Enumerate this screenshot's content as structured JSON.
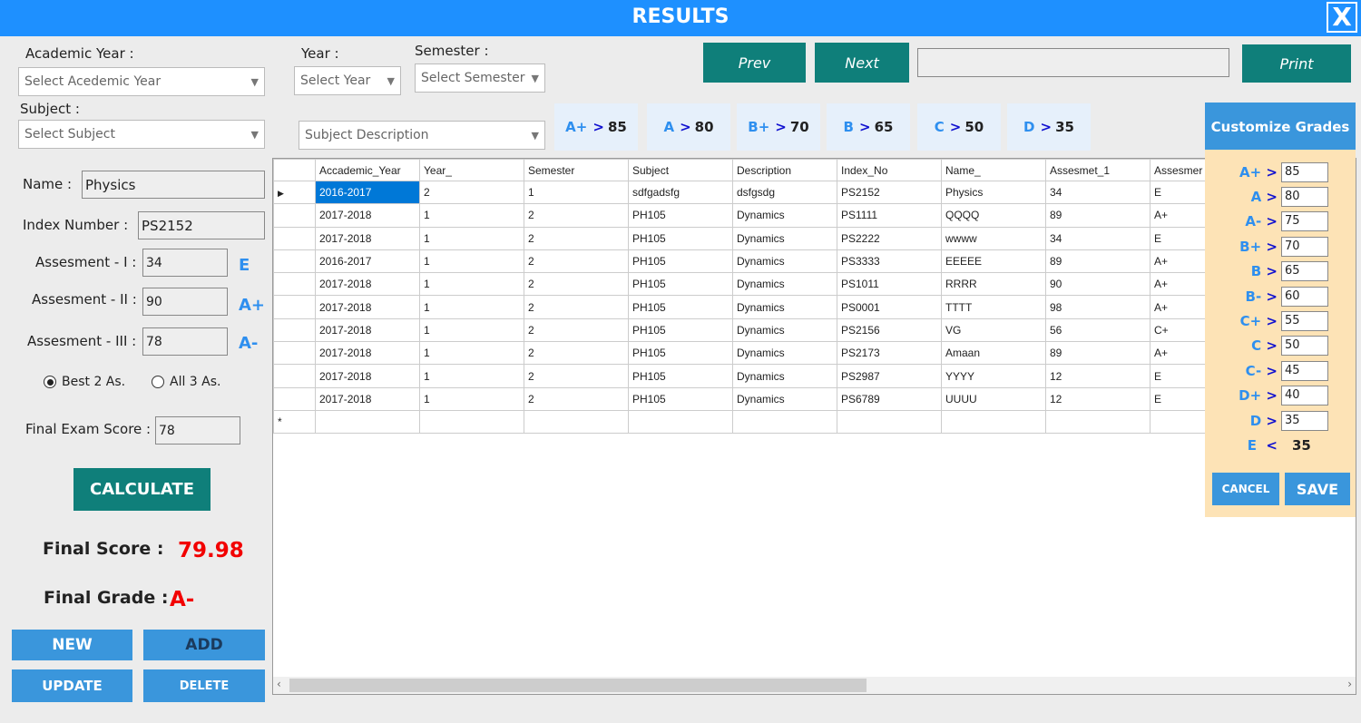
{
  "title": "RESULTS",
  "close_label": "X",
  "filters": {
    "academic_year_label": "Academic Year :",
    "academic_year_value": "Select Acedemic Year",
    "year_label": "Year :",
    "year_value": "Select Year",
    "semester_label": "Semester :",
    "semester_value": "Select Semester",
    "subject_label": "Subject :",
    "subject_value": "Select Subject",
    "description_value": "Subject Description"
  },
  "nav": {
    "prev": "Prev",
    "next": "Next",
    "search_value": "",
    "print": "Print"
  },
  "grade_chips": [
    {
      "g": "A+",
      "v": "85"
    },
    {
      "g": "A",
      "v": "80"
    },
    {
      "g": "B+",
      "v": "70"
    },
    {
      "g": "B",
      "v": "65"
    },
    {
      "g": "C",
      "v": "50"
    },
    {
      "g": "D",
      "v": "35"
    }
  ],
  "form": {
    "name_label": "Name :",
    "name_value": "Physics",
    "index_label": "Index Number :",
    "index_value": "PS2152",
    "a1_label": "Assesment - I :",
    "a1_value": "34",
    "a1_grade": "E",
    "a2_label": "Assesment - II :",
    "a2_value": "90",
    "a2_grade": "A+",
    "a3_label": "Assesment - III :",
    "a3_value": "78",
    "a3_grade": "A-",
    "radio_best": "Best 2 As.",
    "radio_all": "All 3 As.",
    "selected": "best",
    "final_exam_label": "Final Exam Score :",
    "final_exam_value": "78",
    "calculate": "CALCULATE",
    "final_score_label": "Final Score :",
    "final_score_value": "79.98",
    "final_grade_label": "Final Grade :",
    "final_grade_value": "A-"
  },
  "actions": {
    "new": "NEW",
    "add": "ADD",
    "update": "UPDATE",
    "delete": "DELETE"
  },
  "table": {
    "columns": [
      "Accademic_Year",
      "Year_",
      "Semester",
      "Subject",
      "Description",
      "Index_No",
      "Name_",
      "Assesmet_1",
      "Assesmer"
    ],
    "rows": [
      [
        "2016-2017",
        "2",
        "1",
        "sdfgadsfg",
        "dsfgsdg",
        "PS2152",
        "Physics",
        "34",
        "E"
      ],
      [
        "2017-2018",
        "1",
        "2",
        "PH105",
        "Dynamics",
        "PS1111",
        "QQQQ",
        "89",
        "A+"
      ],
      [
        "2017-2018",
        "1",
        "2",
        "PH105",
        "Dynamics",
        "PS2222",
        "wwww",
        "34",
        "E"
      ],
      [
        "2016-2017",
        "1",
        "2",
        "PH105",
        "Dynamics",
        "PS3333",
        "EEEEE",
        "89",
        "A+"
      ],
      [
        "2017-2018",
        "1",
        "2",
        "PH105",
        "Dynamics",
        "PS1011",
        "RRRR",
        "90",
        "A+"
      ],
      [
        "2017-2018",
        "1",
        "2",
        "PH105",
        "Dynamics",
        "PS0001",
        "TTTT",
        "98",
        "A+"
      ],
      [
        "2017-2018",
        "1",
        "2",
        "PH105",
        "Dynamics",
        "PS2156",
        "VG",
        "56",
        "C+"
      ],
      [
        "2017-2018",
        "1",
        "2",
        "PH105",
        "Dynamics",
        "PS2173",
        "Amaan",
        "89",
        "A+"
      ],
      [
        "2017-2018",
        "1",
        "2",
        "PH105",
        "Dynamics",
        "PS2987",
        "YYYY",
        "12",
        "E"
      ],
      [
        "2017-2018",
        "1",
        "2",
        "PH105",
        "Dynamics",
        "PS6789",
        "UUUU",
        "12",
        "E"
      ]
    ]
  },
  "customize": {
    "title": "Customize Grades",
    "grades": [
      {
        "g": "A+",
        "v": "85"
      },
      {
        "g": "A",
        "v": "80"
      },
      {
        "g": "A-",
        "v": "75"
      },
      {
        "g": "B+",
        "v": "70"
      },
      {
        "g": "B",
        "v": "65"
      },
      {
        "g": "B-",
        "v": "60"
      },
      {
        "g": "C+",
        "v": "55"
      },
      {
        "g": "C",
        "v": "50"
      },
      {
        "g": "C-",
        "v": "45"
      },
      {
        "g": "D+",
        "v": "40"
      },
      {
        "g": "D",
        "v": "35"
      }
    ],
    "e_label": "E",
    "e_value": "35",
    "cancel": "CANCEL",
    "save": "SAVE"
  }
}
